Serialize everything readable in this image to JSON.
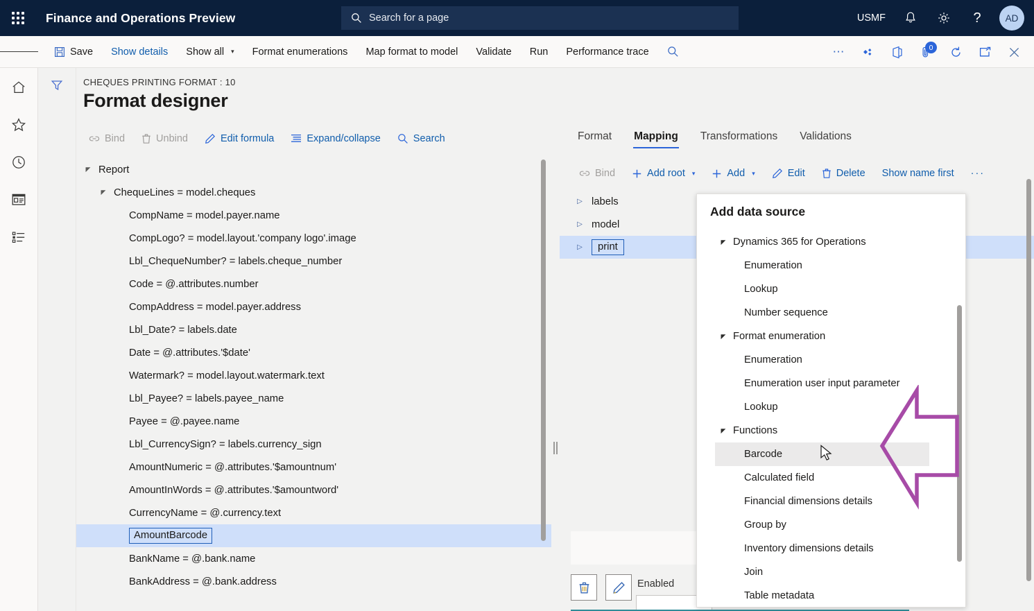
{
  "topnav": {
    "waffle_icon": "app-launcher-icon",
    "app_title": "Finance and Operations Preview",
    "search_placeholder": "Search for a page",
    "search_icon": "search-icon",
    "company": "USMF",
    "bell_icon": "notifications-icon",
    "gear_icon": "settings-icon",
    "help_icon": "help-icon",
    "avatar_initials": "AD"
  },
  "cmdbar": {
    "hamburger_icon": "hamburger-menu-icon",
    "items": [
      {
        "label": "Save",
        "icon": "save-icon",
        "style": "dark"
      },
      {
        "label": "Show details",
        "icon": "",
        "style": "link"
      },
      {
        "label": "Show all",
        "icon": "",
        "style": "dark",
        "chevron": "⌄"
      },
      {
        "label": "Format enumerations",
        "icon": "",
        "style": "dark"
      },
      {
        "label": "Map format to model",
        "icon": "",
        "style": "dark"
      },
      {
        "label": "Validate",
        "icon": "",
        "style": "dark"
      },
      {
        "label": "Run",
        "icon": "",
        "style": "dark"
      },
      {
        "label": "Performance trace",
        "icon": "",
        "style": "dark"
      }
    ],
    "search_icon": "search-icon",
    "right_icons": [
      {
        "name": "overflow-ellipsis-icon"
      },
      {
        "name": "share-icon"
      },
      {
        "name": "office-app-icon"
      },
      {
        "name": "attachments-icon",
        "badge": "0"
      },
      {
        "name": "refresh-icon"
      },
      {
        "name": "popout-icon"
      },
      {
        "name": "close-icon"
      }
    ]
  },
  "rail": {
    "items": [
      {
        "name": "home-icon"
      },
      {
        "name": "favorites-star-icon"
      },
      {
        "name": "recent-clock-icon"
      },
      {
        "name": "workspaces-icon"
      },
      {
        "name": "modules-list-icon"
      }
    ]
  },
  "filterbar": {
    "filter_icon": "filter-funnel-icon"
  },
  "page": {
    "breadcrumb": "CHEQUES PRINTING FORMAT : 10",
    "title": "Format designer"
  },
  "left_pane": {
    "toolbar": [
      {
        "label": "Bind",
        "icon": "bind-link-icon",
        "disabled": true
      },
      {
        "label": "Unbind",
        "icon": "unbind-trash-icon",
        "disabled": true
      },
      {
        "label": "Edit formula",
        "icon": "edit-pencil-icon",
        "disabled": false
      },
      {
        "label": "Expand/collapse",
        "icon": "expand-collapse-icon",
        "disabled": false
      },
      {
        "label": "Search",
        "icon": "search-icon",
        "disabled": false
      }
    ],
    "tree": [
      {
        "label": "Report",
        "indent": 0,
        "twisty": "expanded",
        "selected": false
      },
      {
        "label": "ChequeLines = model.cheques",
        "indent": 1,
        "twisty": "expanded",
        "selected": false
      },
      {
        "label": "CompName = model.payer.name",
        "indent": 2,
        "twisty": "",
        "selected": false
      },
      {
        "label": "CompLogo? = model.layout.'company logo'.image",
        "indent": 2,
        "twisty": "",
        "selected": false
      },
      {
        "label": "Lbl_ChequeNumber? = labels.cheque_number",
        "indent": 2,
        "twisty": "",
        "selected": false
      },
      {
        "label": "Code = @.attributes.number",
        "indent": 2,
        "twisty": "",
        "selected": false
      },
      {
        "label": "CompAddress = model.payer.address",
        "indent": 2,
        "twisty": "",
        "selected": false
      },
      {
        "label": "Lbl_Date? = labels.date",
        "indent": 2,
        "twisty": "",
        "selected": false
      },
      {
        "label": "Date = @.attributes.'$date'",
        "indent": 2,
        "twisty": "",
        "selected": false
      },
      {
        "label": "Watermark? = model.layout.watermark.text",
        "indent": 2,
        "twisty": "",
        "selected": false
      },
      {
        "label": "Lbl_Payee? = labels.payee_name",
        "indent": 2,
        "twisty": "",
        "selected": false
      },
      {
        "label": "Payee = @.payee.name",
        "indent": 2,
        "twisty": "",
        "selected": false
      },
      {
        "label": "Lbl_CurrencySign? = labels.currency_sign",
        "indent": 2,
        "twisty": "",
        "selected": false
      },
      {
        "label": "AmountNumeric = @.attributes.'$amountnum'",
        "indent": 2,
        "twisty": "",
        "selected": false
      },
      {
        "label": "AmountInWords = @.attributes.'$amountword'",
        "indent": 2,
        "twisty": "",
        "selected": false
      },
      {
        "label": "CurrencyName = @.currency.text",
        "indent": 2,
        "twisty": "",
        "selected": false
      },
      {
        "label": "AmountBarcode",
        "indent": 2,
        "twisty": "",
        "selected": true
      },
      {
        "label": "BankName = @.bank.name",
        "indent": 2,
        "twisty": "",
        "selected": false
      },
      {
        "label": "BankAddress = @.bank.address",
        "indent": 2,
        "twisty": "",
        "selected": false
      }
    ]
  },
  "right_pane": {
    "tabs": [
      {
        "label": "Format",
        "active": false
      },
      {
        "label": "Mapping",
        "active": true
      },
      {
        "label": "Transformations",
        "active": false
      },
      {
        "label": "Validations",
        "active": false
      }
    ],
    "toolbar": [
      {
        "label": "Bind",
        "icon": "bind-link-icon",
        "disabled": true,
        "chevron": ""
      },
      {
        "label": "Add root",
        "icon": "plus-icon",
        "disabled": false,
        "chevron": "⌄"
      },
      {
        "label": "Add",
        "icon": "plus-icon",
        "disabled": false,
        "chevron": "⌄"
      },
      {
        "label": "Edit",
        "icon": "edit-pencil-icon",
        "disabled": false,
        "chevron": ""
      },
      {
        "label": "Delete",
        "icon": "delete-trash-icon",
        "disabled": false,
        "chevron": ""
      },
      {
        "label": "Show name first",
        "icon": "",
        "disabled": false,
        "chevron": ""
      },
      {
        "label": "···",
        "icon": "",
        "disabled": false,
        "chevron": ""
      }
    ],
    "tree": [
      {
        "label": "labels",
        "selected": false
      },
      {
        "label": "model",
        "selected": false
      },
      {
        "label": "print",
        "selected": true
      }
    ],
    "bottom": {
      "delete_icon": "delete-trash-icon",
      "edit_icon": "edit-pencil-icon",
      "enabled_label": "Enabled"
    }
  },
  "dropdown": {
    "title": "Add data source",
    "items": [
      {
        "label": "Dynamics 365 for Operations",
        "type": "group",
        "highlighted": false
      },
      {
        "label": "Enumeration",
        "type": "child",
        "highlighted": false
      },
      {
        "label": "Lookup",
        "type": "child",
        "highlighted": false
      },
      {
        "label": "Number sequence",
        "type": "child",
        "highlighted": false
      },
      {
        "label": "Format enumeration",
        "type": "group",
        "highlighted": false
      },
      {
        "label": "Enumeration",
        "type": "child",
        "highlighted": false
      },
      {
        "label": "Enumeration user input parameter",
        "type": "child",
        "highlighted": false
      },
      {
        "label": "Lookup",
        "type": "child",
        "highlighted": false
      },
      {
        "label": "Functions",
        "type": "group",
        "highlighted": false
      },
      {
        "label": "Barcode",
        "type": "child",
        "highlighted": true
      },
      {
        "label": "Calculated field",
        "type": "child",
        "highlighted": false
      },
      {
        "label": "Financial dimensions details",
        "type": "child",
        "highlighted": false
      },
      {
        "label": "Group by",
        "type": "child",
        "highlighted": false
      },
      {
        "label": "Inventory dimensions details",
        "type": "child",
        "highlighted": false
      },
      {
        "label": "Join",
        "type": "child",
        "highlighted": false
      },
      {
        "label": "Table metadata",
        "type": "child",
        "highlighted": false
      }
    ]
  },
  "annotation": {
    "arrow_name": "callout-arrow-pointing-to-barcode",
    "arrow_color": "#A74BA7"
  },
  "colors": {
    "nav_background": "#0b1f3b",
    "accent_blue": "#105dac",
    "selection_blue": "#cfdffa",
    "page_background": "#f2f2f1"
  }
}
